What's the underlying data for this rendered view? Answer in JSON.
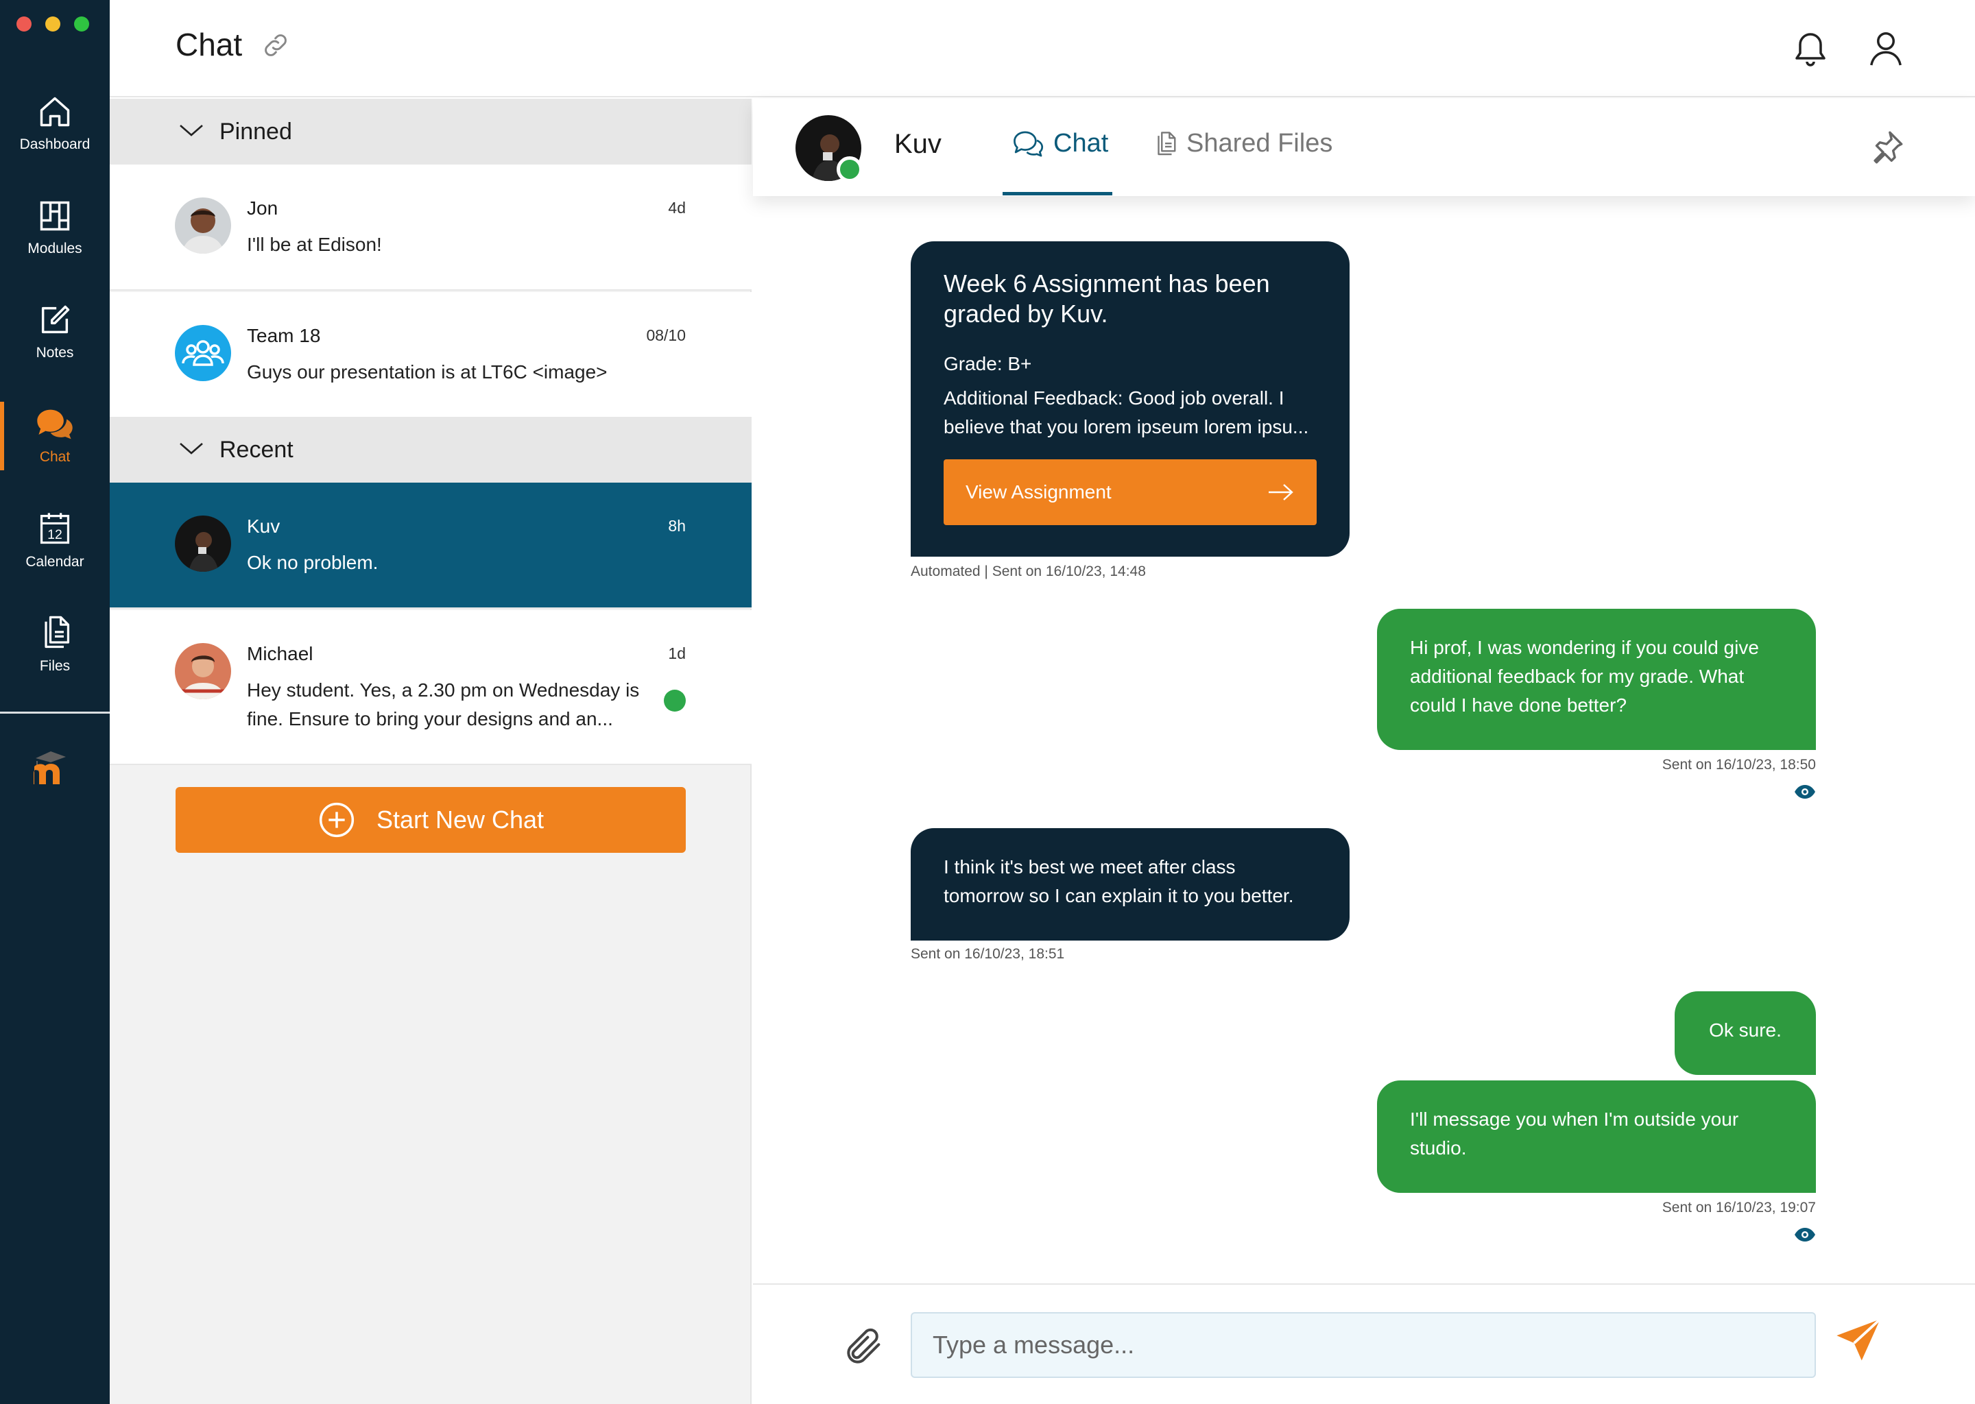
{
  "nav": {
    "items": [
      {
        "label": "Dashboard"
      },
      {
        "label": "Modules"
      },
      {
        "label": "Notes"
      },
      {
        "label": "Chat"
      },
      {
        "label": "Calendar",
        "calendar_day": "12"
      },
      {
        "label": "Files"
      }
    ],
    "active": "Chat"
  },
  "header": {
    "title": "Chat"
  },
  "chat_list": {
    "pinned_label": "Pinned",
    "recent_label": "Recent",
    "pinned": [
      {
        "name": "Jon",
        "time": "4d",
        "preview": "I'll be at Edison!"
      },
      {
        "name": "Team 18",
        "time": "08/10",
        "preview": "Guys our presentation is at LT6C <image>"
      }
    ],
    "recent": [
      {
        "name": "Kuv",
        "time": "8h",
        "preview": "Ok no problem."
      },
      {
        "name": "Michael",
        "time": "1d",
        "preview": "Hey student. Yes, a 2.30 pm on Wednesday is fine. Ensure to bring your designs and an..."
      }
    ],
    "start_button": "Start New Chat"
  },
  "conversation": {
    "contact_name": "Kuv",
    "tabs": [
      {
        "label": "Chat"
      },
      {
        "label": "Shared Files"
      }
    ],
    "messages": [
      {
        "title": "Week 6 Assignment has been graded by Kuv.",
        "grade": "Grade: B+",
        "feedback": "Additional Feedback: Good job overall. I believe that you lorem ipseum lorem ipsu...",
        "button": "View Assignment",
        "meta": "Automated | Sent on 16/10/23, 14:48"
      },
      {
        "text": "Hi prof, I was wondering if you could give additional feedback for my grade. What could I have done better?",
        "meta": "Sent on 16/10/23, 18:50"
      },
      {
        "text": "I think it's best we meet after class tomorrow so I can explain it to you better.",
        "meta": "Sent on 16/10/23, 18:51"
      },
      {
        "text": "Ok sure."
      },
      {
        "text": "I'll message you when I'm outside your studio.",
        "meta": "Sent on 16/10/23, 19:07"
      }
    ],
    "composer_placeholder": "Type a message..."
  },
  "colors": {
    "sidebar": "#0d2535",
    "accent": "#f0821e",
    "selected": "#0b5a7a",
    "sent_bubble": "#2e9a3f",
    "received_bubble": "#0d2535",
    "online": "#2da84a"
  }
}
